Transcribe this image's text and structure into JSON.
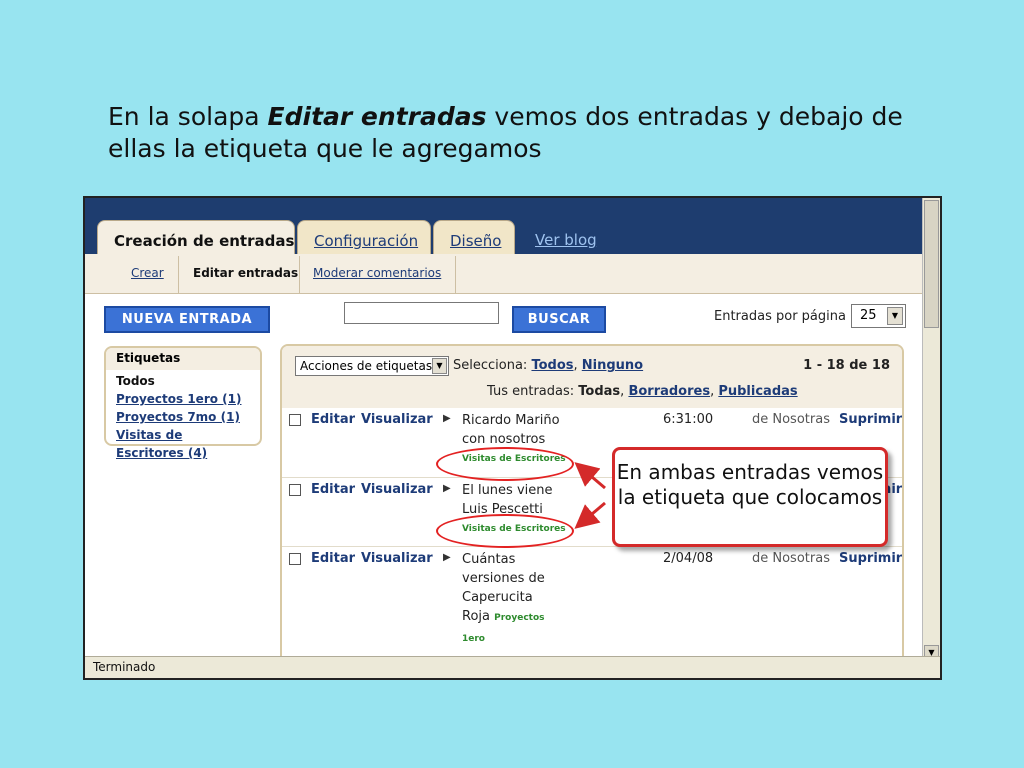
{
  "caption": {
    "part1": "En la solapa ",
    "emphasis": "Editar entradas",
    "part2": " vemos dos entradas y debajo de ellas la etiqueta que le agregamos"
  },
  "tabs": [
    {
      "label": "Creación de entradas"
    },
    {
      "label": "Configuración"
    },
    {
      "label": "Diseño"
    },
    {
      "label": "Ver blog"
    }
  ],
  "subnav": [
    {
      "label": "Crear"
    },
    {
      "label": "Editar entradas"
    },
    {
      "label": "Moderar comentarios"
    }
  ],
  "toolbar": {
    "new_post": "NUEVA ENTRADA",
    "search": "BUSCAR",
    "per_page_label": "Entradas por página",
    "per_page_value": "25"
  },
  "labels": {
    "title": "Etiquetas",
    "current": "Todos",
    "items": [
      "Proyectos 1ero (1)",
      "Proyectos 7mo (1)",
      "Visitas de Escritores (4)"
    ]
  },
  "posts_header": {
    "actions_select": "Acciones de etiquetas...",
    "select_label": "Selecciona:",
    "select_all": "Todos",
    "select_none": "Ninguno",
    "count": "1 - 18 de 18",
    "your_posts": "Tus entradas:",
    "all": "Todas",
    "drafts": "Borradores",
    "published": "Publicadas"
  },
  "posts": [
    {
      "edit": "Editar",
      "view": "Visualizar",
      "title": "Ricardo Mariño con nosotros",
      "tag": "Visitas de Escritores",
      "time": "6:31:00",
      "author": "de Nosotras",
      "delete": "Suprimir"
    },
    {
      "edit": "Editar",
      "view": "Visualizar",
      "title": "El lunes viene Luis Pescetti",
      "tag": "Visitas de Escritores",
      "time": "",
      "author": "",
      "delete": "Suprimir"
    },
    {
      "edit": "Editar",
      "view": "Visualizar",
      "title": "Cuántas versiones de Caperucita Roja",
      "tag": "Proyectos 1ero",
      "time": "2/04/08",
      "author": "de Nosotras",
      "delete": "Suprimir"
    }
  ],
  "callout": "En ambas entradas vemos la etiqueta que colocamos",
  "status": "Terminado",
  "colors": {
    "background": "#98e4f0",
    "header": "#1e3d6f",
    "button": "#3b72d6",
    "callout_border": "#d42a2a",
    "tag": "#2e8b2e"
  }
}
